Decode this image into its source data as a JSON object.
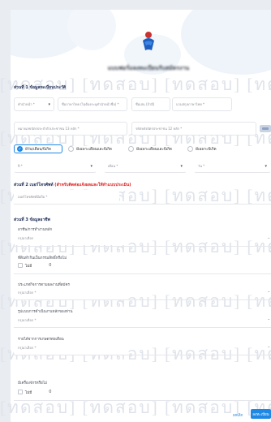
{
  "header": {
    "title": "แบบฟอร์มลงทะเบียนรับสมัครงาน"
  },
  "watermark": "[ทดสอบ] [ทดสอบ] [ทดสอบ] [ทดสอบ]",
  "section1": {
    "title": "ส่วนที่ 1 ข้อมูลทะเบียนประวัติ",
    "prefix": "คำนำหน้า *",
    "first_name": "ชื่อภาษาไทย (ไม่ต้องระบุคำนำหน้าชื่อ) *",
    "nickname": "ชื่อเล่น (ถ้ามี)",
    "last_name": "นามสกุลภาษาไทย *",
    "id_card": "หมายเลขบัตรประจำตัวประชาชน 13 หลัก *",
    "laser_code": "รหัสหลังบัตรประชาชน 12 หลัก *",
    "birth_options": [
      "มีวัน/เดือน/ปีเกิด",
      "มีเฉพาะเดือนและปีเกิด",
      "มีเฉพาะเดือนและปีเกิด",
      "มีเฉพาะปีเกิด"
    ],
    "year": "ปี *",
    "month": "เดือน *",
    "day": "วัน *"
  },
  "section2": {
    "title": "ส่วนที่ 2 เบอร์โทรศัพท์",
    "note": "(สำหรับติดต่อแจ้งผลและให้ทำแบบประเมิน)",
    "phone": "เบอร์โทรศัพท์มือถือ *"
  },
  "section3": {
    "title": "ส่วนที่ 3 ข้อมูลอาชีพ",
    "occupation_label": "อาชีพ/การทำงานหลัก",
    "occupation_value": "กรุณาเลือก",
    "has_land_label": "ที่ดินทำกินเป็นกรรมสิทธิ์หรือไม่",
    "has_land_option": "ไม่มี",
    "has_land_count": "0",
    "business_type_label": "ประเภทกิจการตามผลงานที่สมัคร",
    "business_type_value": "กรุณาเลือก *",
    "product_label": "รูปแบบการดำเนินงานหลักของท่าน",
    "product_value": "กรุณาเลือก *",
    "skills_label": "รายได้จากการเกษตรต่อเดือน",
    "skills_value": "กรุณาเลือก *",
    "tools_label": "มีเครื่องจักรหรือไม่",
    "tools_option": "ไม่มี",
    "tools_count": "0"
  },
  "footer": {
    "clear_label": "ยกเลิก",
    "submit_label": "ลงทะเบียน"
  }
}
